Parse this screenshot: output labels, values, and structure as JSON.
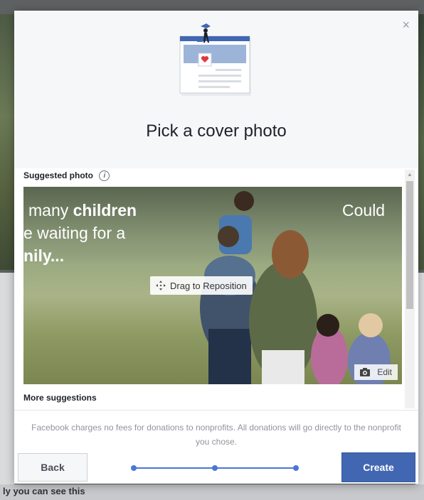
{
  "background": {
    "bottom_text": "ly you can see this"
  },
  "modal": {
    "close_glyph": "×",
    "title": "Pick a cover photo",
    "suggested_label": "Suggested photo",
    "info_glyph": "i",
    "photo": {
      "line1_prefix": "many ",
      "line1_bold": "children",
      "line2": "e waiting for a",
      "line3": "nily...",
      "right_text": "Could",
      "drag_label": "Drag to Reposition",
      "edit_label": "Edit"
    },
    "more_label": "More suggestions",
    "footer_text": "Facebook charges no fees for donations to nonprofits. All donations will go directly to the nonprofit you chose.",
    "back_label": "Back",
    "create_label": "Create",
    "progress": {
      "steps": 3,
      "current": 3
    }
  },
  "colors": {
    "accent": "#4267b2",
    "progress": "#4a76d6"
  },
  "icons": [
    "close-icon",
    "info-icon",
    "move-icon",
    "camera-icon",
    "cover-illustration"
  ]
}
